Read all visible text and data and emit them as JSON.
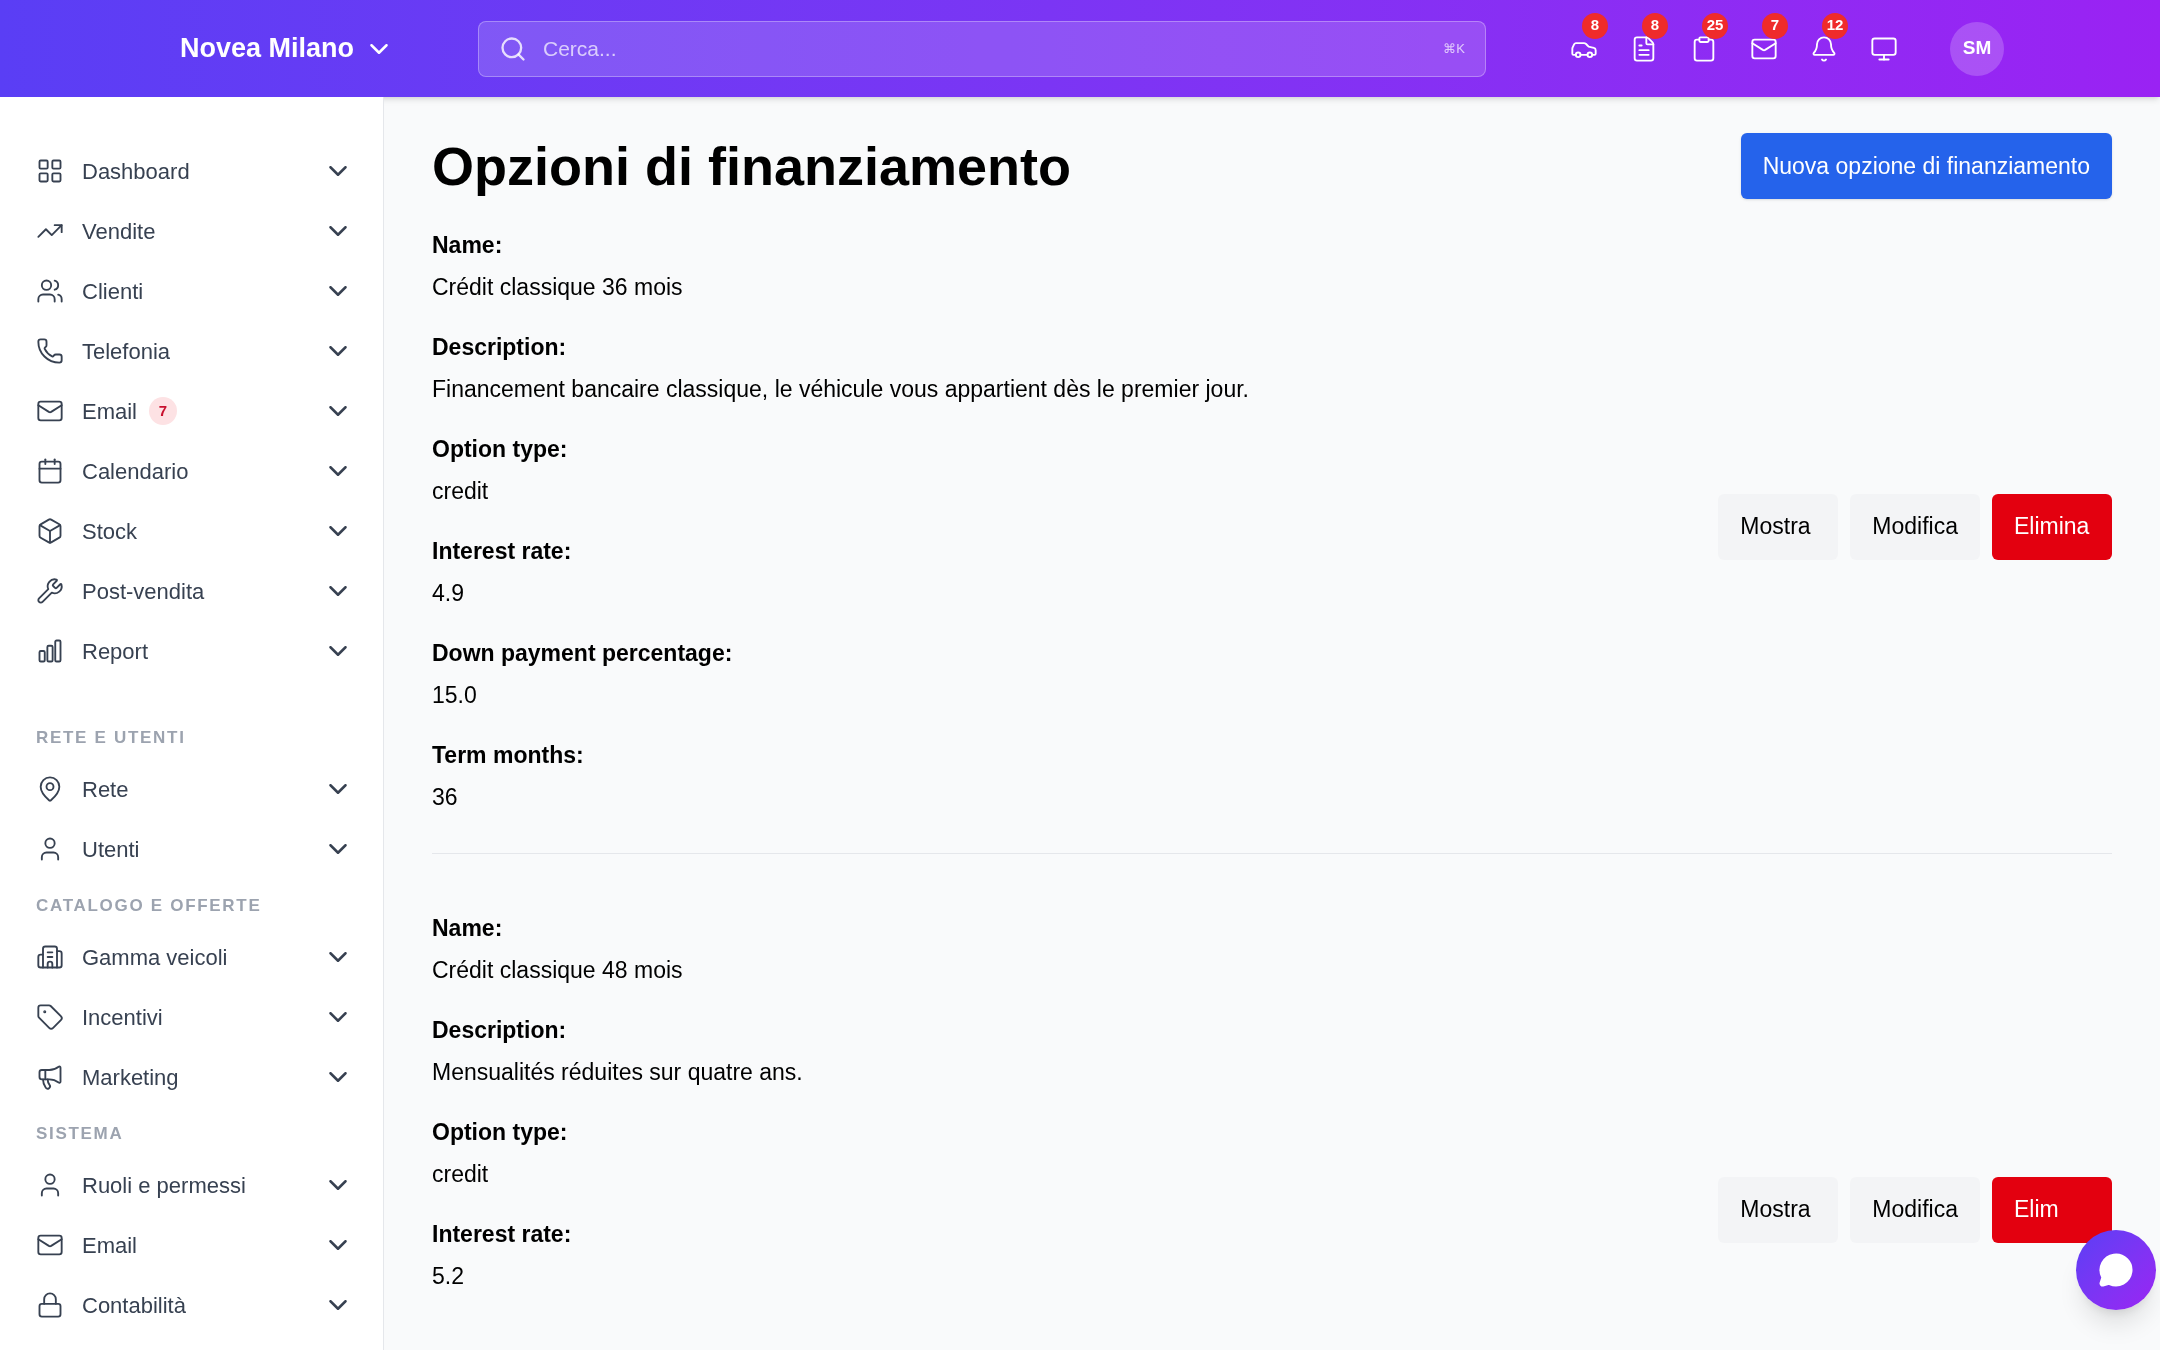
{
  "header": {
    "org": "Novea Milano",
    "search": {
      "placeholder": "Cerca...",
      "shortcut": "⌘K"
    },
    "icons": [
      {
        "badge": "8"
      },
      {
        "badge": "8"
      },
      {
        "badge": "25"
      },
      {
        "badge": "7"
      },
      {
        "badge": "12"
      }
    ],
    "avatar": "SM"
  },
  "sidebar": {
    "groups": [
      {
        "items": [
          {
            "label": "Dashboard"
          },
          {
            "label": "Vendite"
          },
          {
            "label": "Clienti"
          },
          {
            "label": "Telefonia"
          },
          {
            "label": "Email",
            "badge": "7"
          },
          {
            "label": "Calendario"
          },
          {
            "label": "Stock"
          },
          {
            "label": "Post-vendita"
          },
          {
            "label": "Report"
          }
        ]
      },
      {
        "heading": "RETE E UTENTI",
        "items": [
          {
            "label": "Rete"
          },
          {
            "label": "Utenti"
          }
        ]
      },
      {
        "heading": "CATALOGO E OFFERTE",
        "items": [
          {
            "label": "Gamma veicoli"
          },
          {
            "label": "Incentivi"
          },
          {
            "label": "Marketing"
          }
        ]
      },
      {
        "heading": "SISTEMA",
        "items": [
          {
            "label": "Ruoli e permessi"
          },
          {
            "label": "Email"
          },
          {
            "label": "Contabilità"
          }
        ]
      }
    ]
  },
  "page": {
    "title": "Opzioni di finanziamento",
    "new_button": "Nuova opzione di finanziamento"
  },
  "records": [
    {
      "fields": [
        {
          "label": "Name:",
          "value": "Crédit classique 36 mois"
        },
        {
          "label": "Description:",
          "value": "Financement bancaire classique, le véhicule vous appartient dès le premier jour."
        },
        {
          "label": "Option type:",
          "value": "credit"
        },
        {
          "label": "Interest rate:",
          "value": "4.9"
        },
        {
          "label": "Down payment percentage:",
          "value": "15.0"
        },
        {
          "label": "Term months:",
          "value": "36"
        }
      ],
      "actions": [
        {
          "label": "Mostra",
          "kind": "secondary"
        },
        {
          "label": "Modifica",
          "kind": "secondary"
        },
        {
          "label": "Elimina",
          "kind": "danger"
        }
      ]
    },
    {
      "fields": [
        {
          "label": "Name:",
          "value": "Crédit classique 48 mois"
        },
        {
          "label": "Description:",
          "value": "Mensualités réduites sur quatre ans."
        },
        {
          "label": "Option type:",
          "value": "credit"
        },
        {
          "label": "Interest rate:",
          "value": "5.2"
        }
      ],
      "actions": [
        {
          "label": "Mostra",
          "kind": "secondary"
        },
        {
          "label": "Modifica",
          "kind": "secondary"
        },
        {
          "label": "Elim",
          "kind": "danger"
        }
      ]
    }
  ]
}
